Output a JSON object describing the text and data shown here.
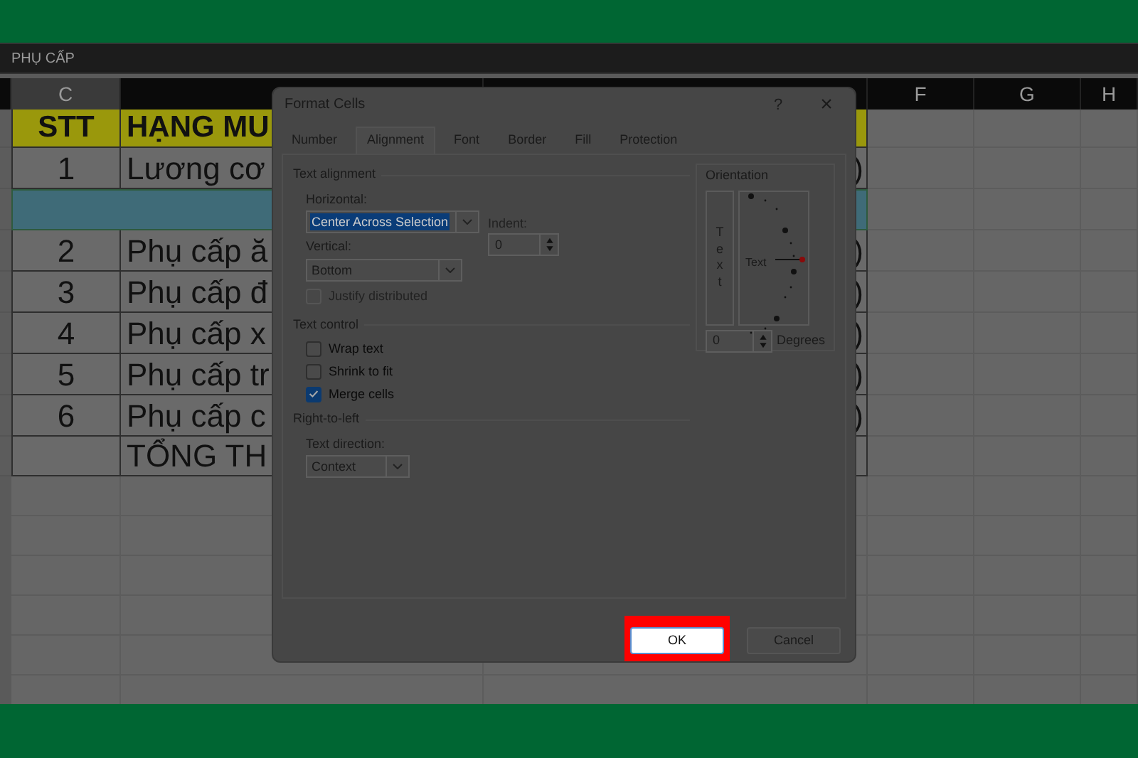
{
  "sheet": {
    "title": "PHỤ CẤP",
    "column_headers": [
      {
        "label": "C"
      },
      {
        "label": "F"
      },
      {
        "label": "G"
      },
      {
        "label": "H"
      }
    ],
    "rows": [
      {
        "kind": "header",
        "stt": "STT",
        "item": "HẠNG MU"
      },
      {
        "kind": "data",
        "stt": "1",
        "item": "Lương cơ",
        "column_e": ")"
      },
      {
        "kind": "band"
      },
      {
        "kind": "data",
        "stt": "2",
        "item": "Phụ cấp ă",
        "column_e": ")"
      },
      {
        "kind": "data",
        "stt": "3",
        "item": "Phụ cấp đ",
        "column_e": ")"
      },
      {
        "kind": "data",
        "stt": "4",
        "item": "Phụ cấp x",
        "column_e": ")"
      },
      {
        "kind": "data",
        "stt": "5",
        "item": "Phụ cấp tr",
        "column_e": ")"
      },
      {
        "kind": "data",
        "stt": "6",
        "item": "Phụ cấp c",
        "column_e": ")"
      },
      {
        "kind": "total",
        "item": "TỔNG TH"
      }
    ]
  },
  "dialog": {
    "title": "Format Cells",
    "help": "?",
    "close": "×",
    "tabs": [
      {
        "label": "Number",
        "selected": false
      },
      {
        "label": "Alignment",
        "selected": true
      },
      {
        "label": "Font",
        "selected": false
      },
      {
        "label": "Border",
        "selected": false
      },
      {
        "label": "Fill",
        "selected": false
      },
      {
        "label": "Protection",
        "selected": false
      }
    ],
    "text_alignment": {
      "title": "Text alignment",
      "horizontal": {
        "label": "Horizontal:",
        "value": "Center Across Selection",
        "text_selected": true
      },
      "indent": {
        "label": "Indent:",
        "value": "0"
      },
      "vertical": {
        "label": "Vertical:",
        "value": "Bottom",
        "text_selected": false
      },
      "justify": {
        "label": "Justify distributed",
        "checked": false,
        "disabled": true
      }
    },
    "text_control": {
      "title": "Text control",
      "options": [
        {
          "label": "Wrap text",
          "checked": false
        },
        {
          "label": "Shrink to fit",
          "checked": false
        },
        {
          "label": "Merge cells",
          "checked": true
        }
      ]
    },
    "right_to_left": {
      "title": "Right-to-left",
      "direction": {
        "label": "Text direction:",
        "value": "Context"
      }
    },
    "orientation": {
      "title": "Orientation",
      "vertical_text": "Text",
      "dial_text": "Text",
      "degrees": {
        "value": "0",
        "label": "Degrees"
      }
    },
    "buttons": [
      {
        "label": "OK",
        "highlighted": true
      },
      {
        "label": "Cancel",
        "highlighted": false
      }
    ]
  }
}
